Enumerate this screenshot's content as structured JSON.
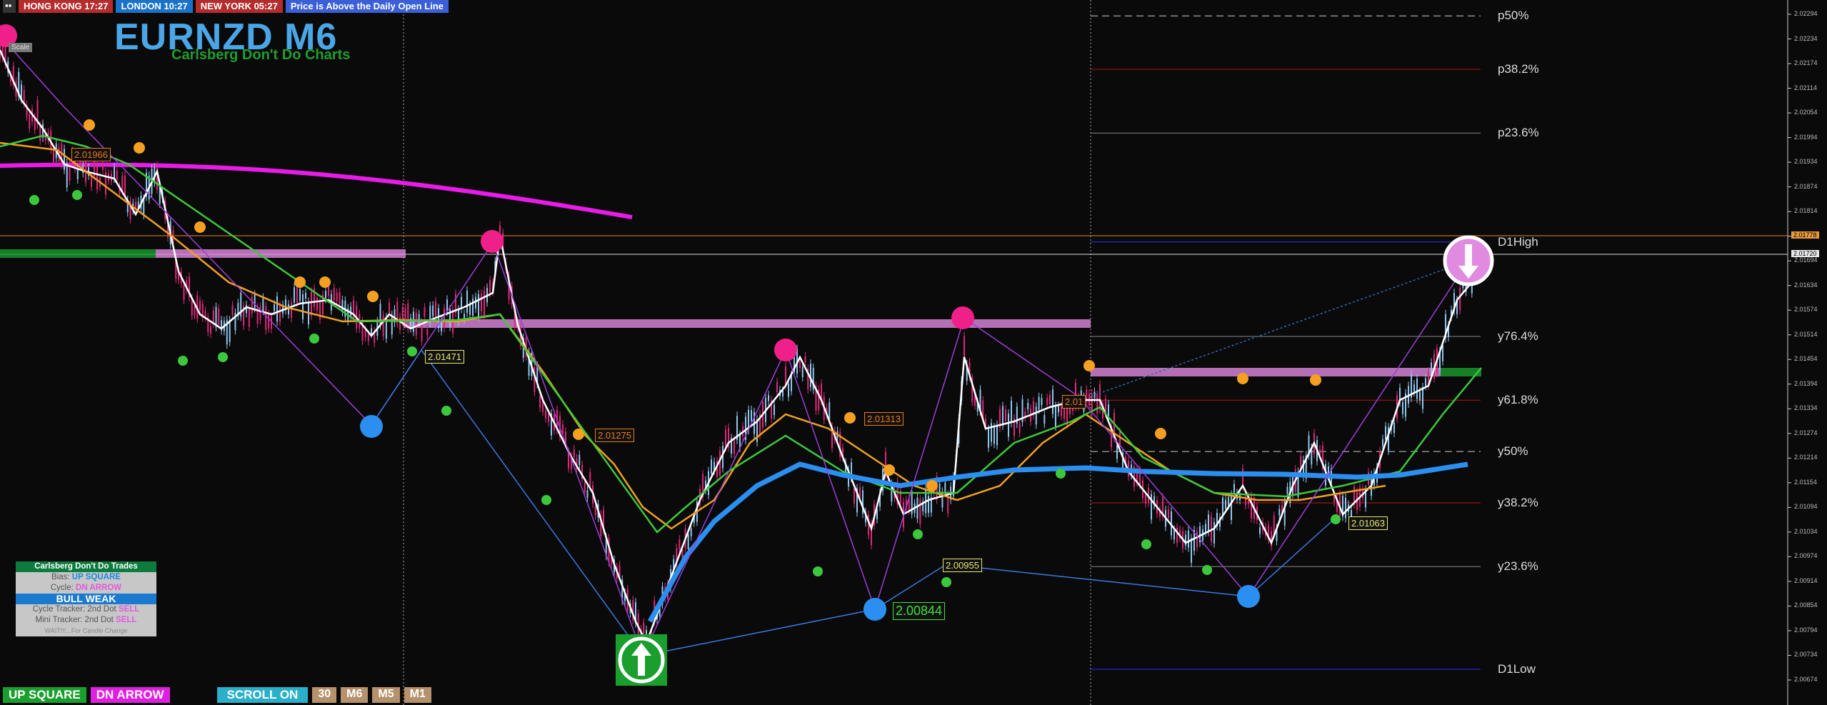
{
  "header": {
    "sessions": [
      {
        "label": "HONG KONG 17:27",
        "color": "#b52c2c"
      },
      {
        "label": "LONDON  10:27",
        "color": "#1a73c9"
      },
      {
        "label": "NEW YORK  05:27",
        "color": "#b52c2c"
      },
      {
        "label": "Price is Above the Daily Open Line",
        "color": "#3b5fd6"
      }
    ],
    "title": "EURNZD M6",
    "subtitle": "Carlsberg Don't Do Charts",
    "scale_label": "Scale"
  },
  "fib_levels": [
    {
      "label": "p50%",
      "price": 2.0229,
      "color": "#cccccc",
      "dashed": true
    },
    {
      "label": "p38.2%",
      "price": 2.0216,
      "color": "#b01818"
    },
    {
      "label": "p23.6%",
      "price": 2.02005,
      "color": "#888888"
    },
    {
      "label": "D1High",
      "price": 2.0174,
      "color": "#3030ff"
    },
    {
      "label": "y76.4%",
      "price": 2.0151,
      "color": "#888888"
    },
    {
      "label": "y61.8%",
      "price": 2.01355,
      "color": "#b01818"
    },
    {
      "label": "y50%",
      "price": 2.0123,
      "color": "#cccccc",
      "dashed": true
    },
    {
      "label": "y38.2%",
      "price": 2.01105,
      "color": "#b01818"
    },
    {
      "label": "y23.6%",
      "price": 2.0095,
      "color": "#888888"
    },
    {
      "label": "D1Low",
      "price": 2.007,
      "color": "#3030ff"
    }
  ],
  "price_boxes": [
    {
      "label": "2.01966",
      "color": "#e67a1a"
    },
    {
      "label": "2.01471",
      "color": "#e8e870"
    },
    {
      "label": "2.01275",
      "color": "#e67a1a"
    },
    {
      "label": "2.01313",
      "color": "#e67a1a"
    },
    {
      "label": "2.01",
      "color": "#e67a1a"
    },
    {
      "label": "2.00955",
      "color": "#e8e870"
    },
    {
      "label": "2.00844",
      "color": "#3de03d"
    },
    {
      "label": "2.01063",
      "color": "#e8e870"
    }
  ],
  "price_axis": {
    "ticks": [
      "2.02294",
      "2.02234",
      "2.02174",
      "2.02114",
      "2.02054",
      "2.01994",
      "2.01934",
      "2.01874",
      "2.01814",
      "2.01754",
      "2.01694",
      "2.01634",
      "2.01574",
      "2.01514",
      "2.01454",
      "2.01394",
      "2.01334",
      "2.01274",
      "2.01214",
      "2.01154",
      "2.01094",
      "2.01034",
      "2.00974",
      "2.00914",
      "2.00854",
      "2.00794",
      "2.00734",
      "2.00674"
    ],
    "tag_high": {
      "label": "2.01778",
      "color": "#e89a3a"
    },
    "tag_price": {
      "label": "2.01720",
      "color": "#e8e8e8"
    }
  },
  "info_panel": {
    "heading": "Carlsberg Don't Do Trades",
    "bias_label": "Bias:",
    "bias_value": "UP SQUARE",
    "cycle_label": "Cycle:",
    "cycle_value": "DN ARROW",
    "state": "BULL WEAK",
    "cycle_tracker": "Cycle Tracker: 2nd Dot",
    "cycle_tracker_value": "SELL",
    "mini_tracker": "Mini Tracker: 2nd Dot",
    "mini_tracker_value": "SELL",
    "wait": "WAIT!!!...For Candle Change"
  },
  "bottom_bar": {
    "up_square": "UP SQUARE",
    "dn_arrow": "DN ARROW",
    "scroll": "SCROLL ON",
    "tf_buttons": [
      "30",
      "M6",
      "M5",
      "M1"
    ]
  },
  "colors": {
    "bull": "#8ec8f0",
    "bear": "#e0287a",
    "ema_white": "#ffffff",
    "ema_orange": "#f0a020",
    "ema_green": "#3cc83c",
    "ema_blue": "#2a8ff0",
    "ma_magenta": "#e81be8"
  }
}
